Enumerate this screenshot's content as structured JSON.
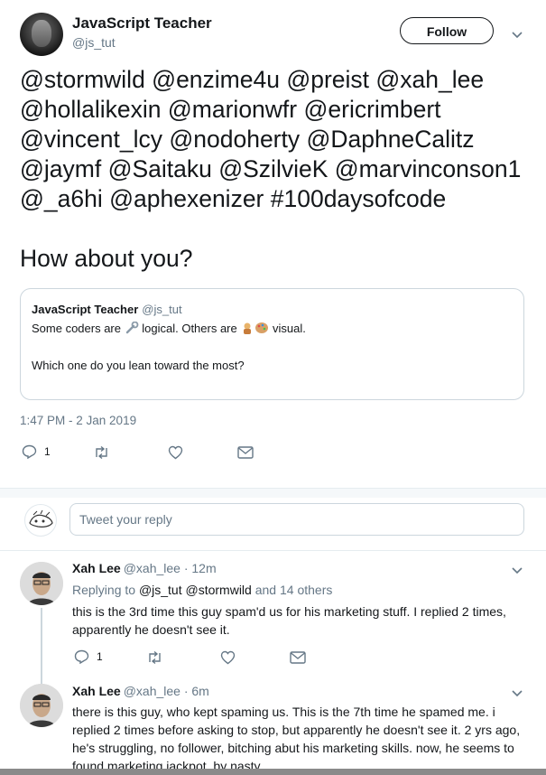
{
  "tweet": {
    "author_name": "JavaScript Teacher",
    "author_handle": "@js_tut",
    "follow_label": "Follow",
    "text_lines": [
      "@stormwild @enzime4u @preist @xah_lee",
      "@hollalikexin @marionwfr @ericrimbert",
      "@vincent_lcy @nodoherty @DaphneCalitz",
      "@jaymf @Saitaku @SzilvieK @marvinconson1",
      "@_a6hi @aphexenizer #100daysofcode",
      "How about you?"
    ],
    "timestamp": "1:47 PM - 2 Jan 2019",
    "actions": {
      "reply_count": "1"
    }
  },
  "quoted": {
    "name": "JavaScript Teacher",
    "handle": "@js_tut",
    "line1_a": "Some coders are",
    "line1_b": "logical. Others are",
    "line1_c": "visual.",
    "line2": "Which one do you lean toward the most?"
  },
  "reply_box": {
    "placeholder": "Tweet your reply"
  },
  "replies": [
    {
      "name": "Xah Lee",
      "meta": "@xah_lee · 12m",
      "replying_label": "Replying to",
      "replying_to": "@js_tut @stormwild",
      "replying_and": "and",
      "replying_others": "14 others",
      "body": "this is the 3rd time this guy spam'd us for his marketing stuff. I replied 2 times, apparently he doesn't see it.",
      "reply_count": "1"
    },
    {
      "name": "Xah Lee",
      "meta": "@xah_lee · 6m",
      "body": "there is this guy, who kept spaming us. This is the 7th time he spamed me. i replied 2 times before asking to stop, but apparently he doesn't see it. 2 yrs ago, he's struggling, no follower, bitching abut his marketing skills. now, he seems to found marketing jackpot, by nasty."
    }
  ],
  "colors": {
    "text": "#14171a",
    "muted": "#657786",
    "link": "#1da1f2",
    "border": "#e6ecf0"
  },
  "icons": [
    "reply-icon",
    "retweet-icon",
    "like-icon",
    "message-icon",
    "chevron-down-icon"
  ]
}
